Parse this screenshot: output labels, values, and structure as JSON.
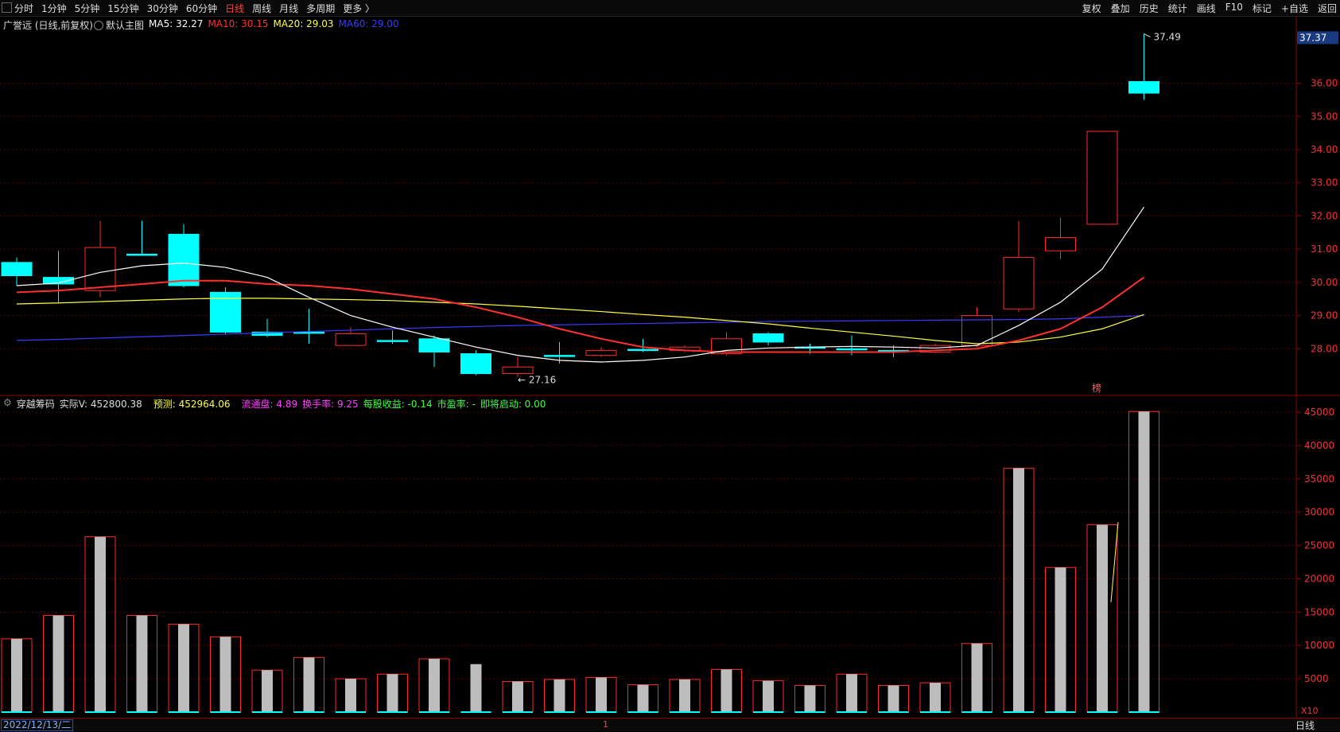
{
  "topbar": {
    "periods": [
      "分时",
      "1分钟",
      "5分钟",
      "15分钟",
      "30分钟",
      "60分钟",
      "日线",
      "周线",
      "月线",
      "多周期",
      "更多 〉"
    ],
    "active_period": "日线",
    "tools": [
      "复权",
      "叠加",
      "历史",
      "统计",
      "画线",
      "F10",
      "标记",
      "+自选",
      "返回"
    ]
  },
  "main": {
    "stock": "广誉远 (日线,前复权)",
    "template": "默认主图",
    "ma5": {
      "label": "MA5: 32.27",
      "color": "#ffffff"
    },
    "ma10": {
      "label": "MA10: 30.15",
      "color": "#ff3030"
    },
    "ma20": {
      "label": "MA20: 29.03",
      "color": "#ffff40"
    },
    "ma60": {
      "label": "MA60: 29.00",
      "color": "#3a3aff"
    },
    "price_axis": [
      "36.00",
      "35.00",
      "34.00",
      "33.00",
      "32.00",
      "31.00",
      "30.00",
      "29.00",
      "28.00"
    ],
    "current_price": "37.37",
    "high_label": "37.49",
    "low_label": "27.16",
    "mark_glyph": "榜"
  },
  "sub": {
    "name": "穿越筹码",
    "actual_v": "实际V: 452800.38",
    "forecast": "预测: 452964.06",
    "float_cap": "流通盘: 4.89",
    "turnover": "换手率: 9.25",
    "eps": "每股收益: -0.14",
    "pe": "市盈率: -",
    "start": "即将启动: 0.00",
    "vol_axis": [
      "45000",
      "40000",
      "35000",
      "30000",
      "25000",
      "20000",
      "15000",
      "10000",
      "5000"
    ],
    "multiplier": "X10"
  },
  "bottombar": {
    "date": "2022/12/13/二",
    "period": "日线",
    "marker": "1"
  },
  "colors": {
    "up": "#ff2a2a",
    "down": "#00ffff",
    "grid": "#5a0000"
  },
  "chart_data": {
    "type": "candlestick",
    "candles": [
      {
        "o": 30.6,
        "c": 30.2,
        "h": 30.75,
        "l": 29.9,
        "v": 11000
      },
      {
        "o": 30.15,
        "c": 29.95,
        "h": 30.95,
        "l": 29.4,
        "v": 14500
      },
      {
        "o": 29.75,
        "c": 31.05,
        "h": 31.85,
        "l": 29.55,
        "v": 26300
      },
      {
        "o": 30.85,
        "c": 30.85,
        "h": 31.85,
        "l": 30.8,
        "v": 14500
      },
      {
        "o": 31.45,
        "c": 29.9,
        "h": 31.75,
        "l": 29.85,
        "v": 13200
      },
      {
        "o": 29.7,
        "c": 28.5,
        "h": 29.85,
        "l": 28.45,
        "v": 11300
      },
      {
        "o": 28.5,
        "c": 28.4,
        "h": 28.9,
        "l": 28.35,
        "v": 6300
      },
      {
        "o": 28.5,
        "c": 28.5,
        "h": 29.2,
        "l": 28.15,
        "v": 8200
      },
      {
        "o": 28.1,
        "c": 28.45,
        "h": 28.65,
        "l": 28.1,
        "v": 5000
      },
      {
        "o": 28.25,
        "c": 28.25,
        "h": 28.55,
        "l": 28.15,
        "v": 5700
      },
      {
        "o": 28.3,
        "c": 27.9,
        "h": 28.4,
        "l": 27.45,
        "v": 8000
      },
      {
        "o": 27.85,
        "c": 27.25,
        "h": 27.95,
        "l": 27.2,
        "v": 7200
      },
      {
        "o": 27.25,
        "c": 27.45,
        "h": 27.75,
        "l": 27.16,
        "v": 4600
      },
      {
        "o": 27.8,
        "c": 27.8,
        "h": 28.2,
        "l": 27.55,
        "v": 4900
      },
      {
        "o": 27.8,
        "c": 27.95,
        "h": 28.05,
        "l": 27.75,
        "v": 5200
      },
      {
        "o": 27.98,
        "c": 27.98,
        "h": 28.3,
        "l": 27.9,
        "v": 4100
      },
      {
        "o": 27.95,
        "c": 28.05,
        "h": 28.1,
        "l": 27.9,
        "v": 4900
      },
      {
        "o": 27.85,
        "c": 28.3,
        "h": 28.5,
        "l": 27.8,
        "v": 6400
      },
      {
        "o": 28.45,
        "c": 28.2,
        "h": 28.5,
        "l": 28.1,
        "v": 4700
      },
      {
        "o": 28.05,
        "c": 28.05,
        "h": 28.15,
        "l": 27.85,
        "v": 4000
      },
      {
        "o": 28.0,
        "c": 28.0,
        "h": 28.4,
        "l": 27.8,
        "v": 5700
      },
      {
        "o": 27.95,
        "c": 27.95,
        "h": 28.1,
        "l": 27.75,
        "v": 4000
      },
      {
        "o": 27.9,
        "c": 28.1,
        "h": 28.15,
        "l": 27.85,
        "v": 4400
      },
      {
        "o": 28.1,
        "c": 29.0,
        "h": 29.25,
        "l": 28.05,
        "v": 10300
      },
      {
        "o": 29.2,
        "c": 30.75,
        "h": 31.85,
        "l": 29.1,
        "v": 36600
      },
      {
        "o": 30.95,
        "c": 31.35,
        "h": 31.95,
        "l": 30.7,
        "v": 21700
      },
      {
        "o": 31.75,
        "c": 34.55,
        "h": 34.55,
        "l": 31.75,
        "v": 28100
      },
      {
        "o": 36.05,
        "c": 35.7,
        "h": 37.49,
        "l": 35.5,
        "v": 45100
      }
    ],
    "ma5": [
      29.9,
      29.98,
      30.3,
      30.5,
      30.58,
      30.45,
      30.15,
      29.55,
      29.0,
      28.65,
      28.35,
      28.05,
      27.8,
      27.65,
      27.6,
      27.65,
      27.75,
      27.95,
      28.02,
      28.05,
      28.07,
      28.05,
      28.02,
      28.1,
      28.7,
      29.4,
      30.4,
      32.27
    ],
    "ma10": [
      29.7,
      29.75,
      29.85,
      29.95,
      30.05,
      30.05,
      29.95,
      29.9,
      29.8,
      29.65,
      29.5,
      29.25,
      28.95,
      28.6,
      28.3,
      28.05,
      27.95,
      27.9,
      27.9,
      27.9,
      27.9,
      27.9,
      27.95,
      28.0,
      28.25,
      28.6,
      29.25,
      30.15
    ],
    "ma20": [
      29.35,
      29.38,
      29.42,
      29.46,
      29.5,
      29.52,
      29.52,
      29.5,
      29.48,
      29.45,
      29.4,
      29.35,
      29.28,
      29.2,
      29.12,
      29.03,
      28.95,
      28.85,
      28.75,
      28.62,
      28.5,
      28.38,
      28.25,
      28.15,
      28.2,
      28.35,
      28.6,
      29.03
    ],
    "ma60": [
      28.25,
      28.28,
      28.32,
      28.36,
      28.4,
      28.44,
      28.48,
      28.52,
      28.56,
      28.6,
      28.64,
      28.67,
      28.7,
      28.72,
      28.74,
      28.76,
      28.78,
      28.8,
      28.82,
      28.83,
      28.84,
      28.85,
      28.86,
      28.87,
      28.88,
      28.9,
      28.95,
      29.0
    ],
    "price_ylim": [
      27.0,
      37.5
    ],
    "vol_ylim": [
      0,
      45000
    ]
  }
}
